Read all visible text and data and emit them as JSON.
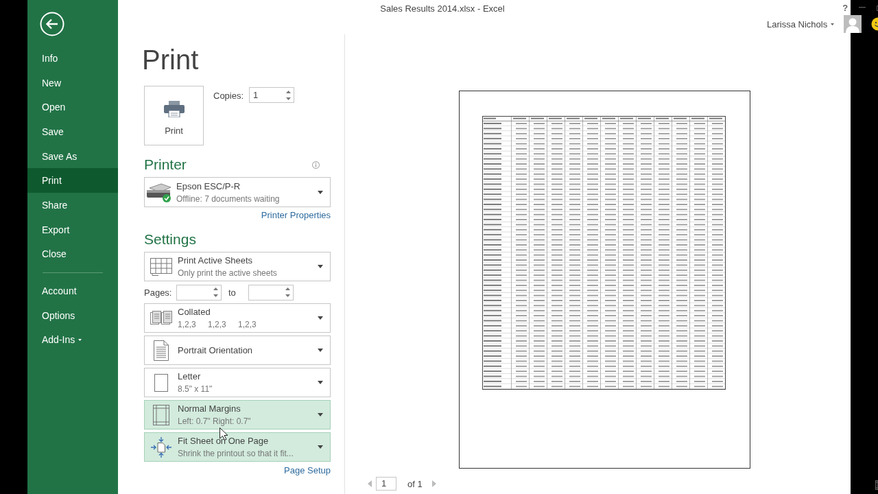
{
  "window": {
    "title": "Sales Results 2014.xlsx - Excel",
    "help": "?",
    "user": "Larissa Nichols"
  },
  "nav": {
    "items": [
      {
        "label": "Info",
        "selected": false,
        "menu": false
      },
      {
        "label": "New",
        "selected": false,
        "menu": false
      },
      {
        "label": "Open",
        "selected": false,
        "menu": false
      },
      {
        "label": "Save",
        "selected": false,
        "menu": false
      },
      {
        "label": "Save As",
        "selected": false,
        "menu": false
      },
      {
        "label": "Print",
        "selected": true,
        "menu": false
      },
      {
        "label": "Share",
        "selected": false,
        "menu": false
      },
      {
        "label": "Export",
        "selected": false,
        "menu": false
      },
      {
        "label": "Close",
        "selected": false,
        "menu": false
      }
    ],
    "lower_items": [
      {
        "label": "Account",
        "selected": false,
        "menu": false
      },
      {
        "label": "Options",
        "selected": false,
        "menu": false
      },
      {
        "label": "Add-Ins",
        "selected": false,
        "menu": true
      }
    ]
  },
  "print": {
    "title": "Print",
    "button": "Print",
    "copies_label": "Copies:",
    "copies": "1"
  },
  "printer": {
    "heading": "Printer",
    "name": "Epson ESC/P-R",
    "status": "Offline: 7 documents waiting",
    "properties_link": "Printer Properties"
  },
  "settings": {
    "heading": "Settings",
    "items": [
      {
        "kind": "sheets",
        "title": "Print Active Sheets",
        "subtitle": "Only print the active sheets",
        "highlighted": false
      },
      {
        "kind": "pages",
        "label": "Pages:",
        "to_label": "to"
      },
      {
        "kind": "collate",
        "title": "Collated",
        "subtitle": "1,2,3 1,2,3 1,2,3",
        "highlighted": false
      },
      {
        "kind": "portrait",
        "title": "Portrait Orientation",
        "highlighted": false
      },
      {
        "kind": "letter",
        "title": "Letter",
        "subtitle": "8.5\" x 11\"",
        "highlighted": false
      },
      {
        "kind": "margins",
        "title": "Normal Margins",
        "subtitle": "Left: 0.7\" Right: 0.7\"",
        "highlighted": true
      },
      {
        "kind": "fit",
        "title": "Fit Sheet on One Page",
        "subtitle": "Shrink the printout so that it fit...",
        "highlighted": true
      }
    ],
    "page_setup_link": "Page Setup"
  },
  "preview": {
    "page": "1",
    "page_count": "of 1"
  }
}
